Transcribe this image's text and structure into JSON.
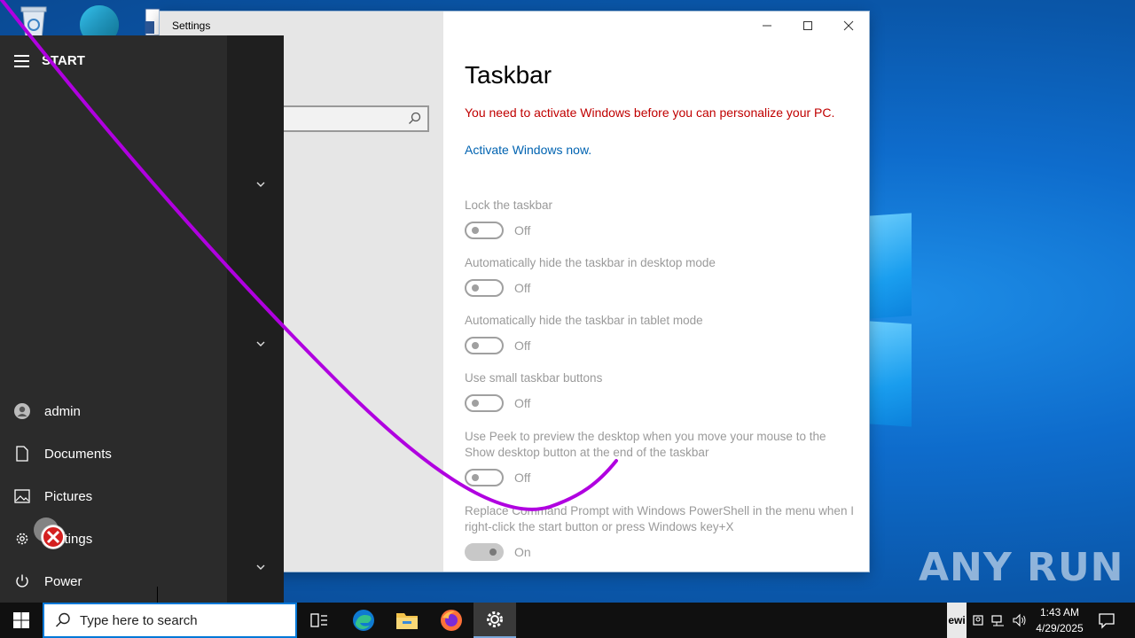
{
  "settings_window": {
    "title": "Settings",
    "page_title": "Taskbar",
    "warning": "You need to activate Windows before you can personalize your PC.",
    "activate_link": "Activate Windows now.",
    "options": [
      {
        "label": "Lock the taskbar",
        "state": "Off",
        "on": false
      },
      {
        "label": "Automatically hide the taskbar in desktop mode",
        "state": "Off",
        "on": false
      },
      {
        "label": "Automatically hide the taskbar in tablet mode",
        "state": "Off",
        "on": false
      },
      {
        "label": "Use small taskbar buttons",
        "state": "Off",
        "on": false
      },
      {
        "label": "Use Peek to preview the desktop when you move your mouse to the Show desktop button at the end of the taskbar",
        "state": "Off",
        "on": false
      },
      {
        "label": "Replace Command Prompt with Windows PowerShell in the menu when I right-click the start button or press Windows key+X",
        "state": "On",
        "on": true
      }
    ]
  },
  "start_menu": {
    "header": "START",
    "items": [
      {
        "label": "admin",
        "icon": "user-icon"
      },
      {
        "label": "Documents",
        "icon": "document-icon"
      },
      {
        "label": "Pictures",
        "icon": "pictures-icon"
      },
      {
        "label": "Settings",
        "icon": "gear-icon"
      },
      {
        "label": "Power",
        "icon": "power-icon"
      }
    ]
  },
  "taskbar": {
    "search_placeholder": "Type here to search",
    "tray_lang": "ewi",
    "time": "1:43 AM",
    "date": "4/29/2025"
  },
  "watermark": "ANY RUN",
  "colors": {
    "accent": "#0078d7",
    "warning": "#c00000",
    "link": "#0063b1",
    "annotation": "#b000e0"
  }
}
